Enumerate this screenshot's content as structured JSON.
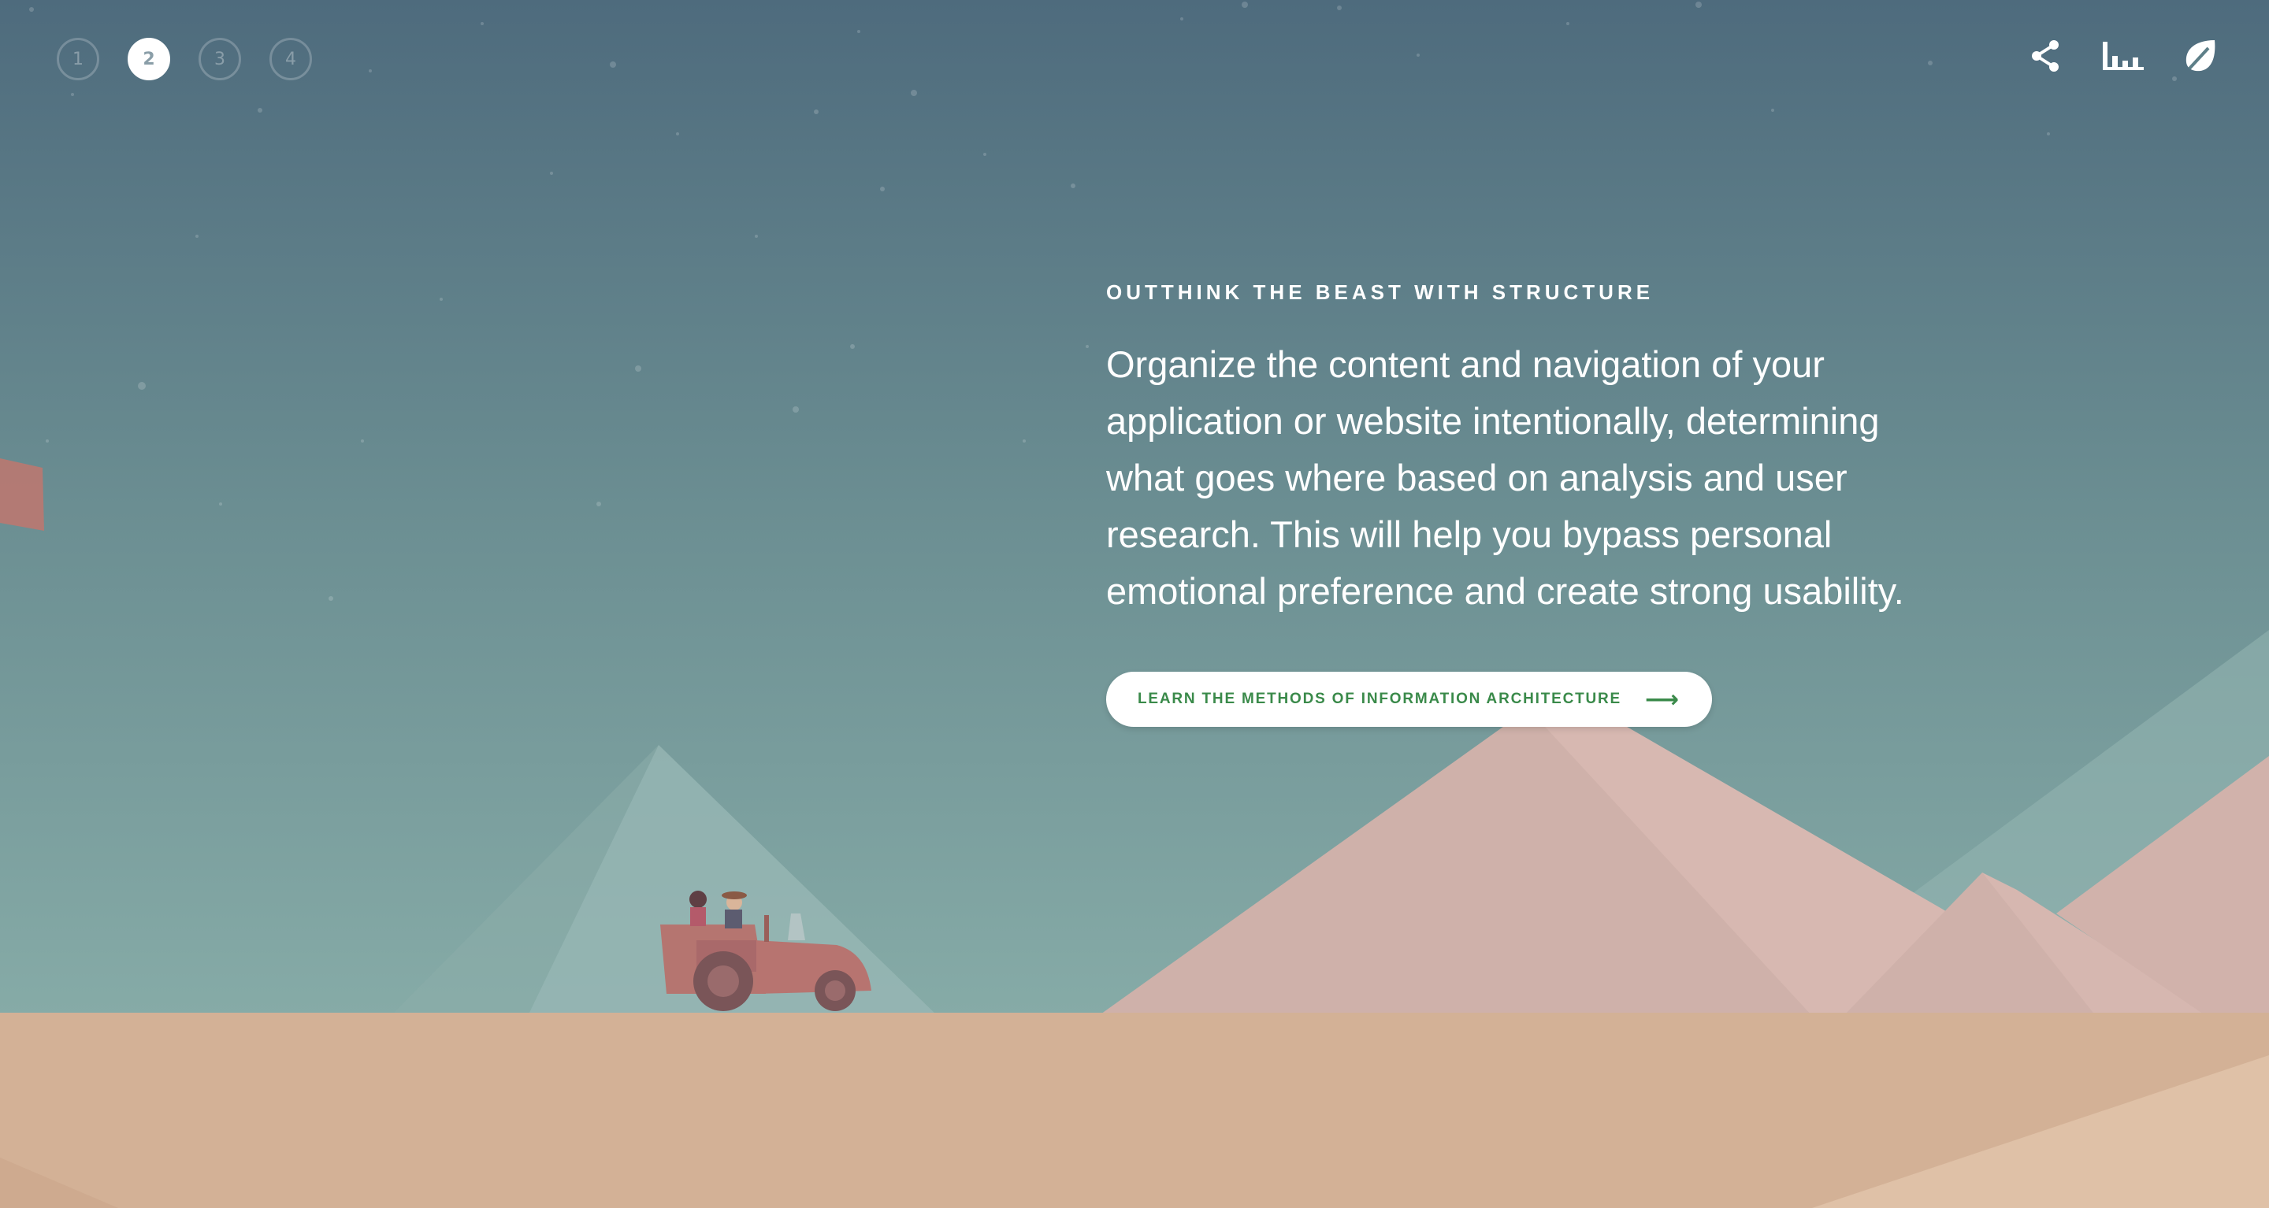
{
  "nav": {
    "steps": [
      {
        "label": "1",
        "active": false
      },
      {
        "label": "2",
        "active": true
      },
      {
        "label": "3",
        "active": false
      },
      {
        "label": "4",
        "active": false
      }
    ]
  },
  "toolbar": {
    "icons": [
      "share-icon",
      "bar-chart-icon",
      "evernote-leaf-icon"
    ]
  },
  "content": {
    "eyebrow": "OUTTHINK THE BEAST WITH STRUCTURE",
    "description": "Organize the content and navigation of your application or website intentionally, determining what goes where based on analysis and user research. This will help you bypass personal emotional preference and create strong usability.",
    "cta_label": "LEARN THE METHODS OF INFORMATION ARCHITECTURE",
    "cta_arrow": "⟶"
  },
  "colors": {
    "sky_top": "#4e6b7d",
    "sky_bottom": "#84a8a5",
    "sand": "#d3b196",
    "mountain_pink": "#cfb1aa",
    "tractor": "#b57570",
    "cta_text": "#3a8a4a"
  }
}
